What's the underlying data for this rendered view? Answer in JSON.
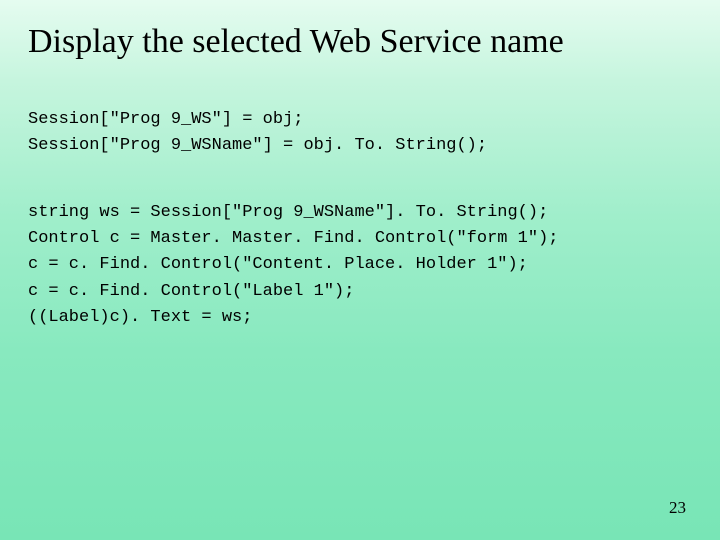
{
  "title": "Display the selected Web Service name",
  "code_block_1": "Session[\"Prog 9_WS\"] = obj;\nSession[\"Prog 9_WSName\"] = obj. To. String();",
  "code_block_2": "string ws = Session[\"Prog 9_WSName\"]. To. String();\nControl c = Master. Master. Find. Control(\"form 1\");\nc = c. Find. Control(\"Content. Place. Holder 1\");\nc = c. Find. Control(\"Label 1\");\n((Label)c). Text = ws;",
  "page_number": "23"
}
